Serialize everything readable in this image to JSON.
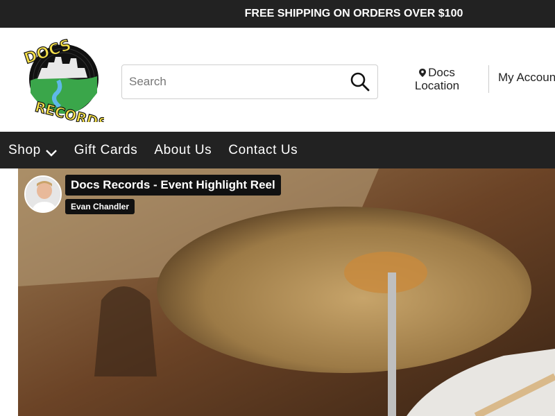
{
  "announcement": {
    "text": "FREE SHIPPING ON ORDERS OVER $100"
  },
  "brand": {
    "logo_text": "DOCS RECORDS"
  },
  "search": {
    "placeholder": "Search"
  },
  "location": {
    "line1": "Docs",
    "line2": "Location"
  },
  "account": {
    "label": "My Accoun"
  },
  "nav": {
    "shop": "Shop",
    "gift_cards": "Gift Cards",
    "about_us": "About Us",
    "contact_us": "Contact Us"
  },
  "video": {
    "title": "Docs Records - Event Highlight Reel",
    "author": "Evan Chandler"
  },
  "colors": {
    "dark_bar": "#222222",
    "logo_yellow": "#f5e04a",
    "logo_green": "#3aa64a"
  },
  "icons": [
    "search-icon",
    "location-pin-icon",
    "chevron-down-icon"
  ]
}
